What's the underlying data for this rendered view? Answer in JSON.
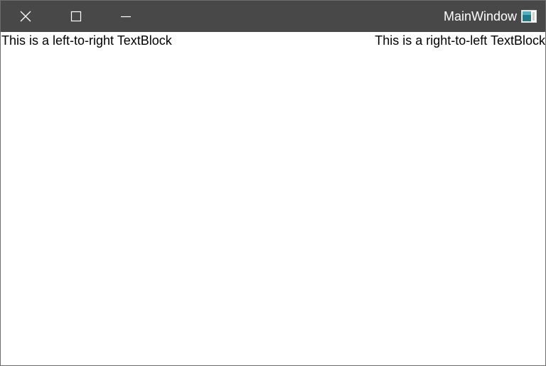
{
  "window": {
    "title": "MainWindow",
    "icon": "app-window-icon",
    "titlebar_color": "#484848"
  },
  "caption_buttons": [
    {
      "name": "close",
      "icon": "close-icon"
    },
    {
      "name": "maximize",
      "icon": "maximize-icon"
    },
    {
      "name": "minimize",
      "icon": "minimize-icon"
    }
  ],
  "content": {
    "left_textblock": "This is a left-to-right TextBlock",
    "right_textblock": "This is a right-to-left TextBlock"
  }
}
